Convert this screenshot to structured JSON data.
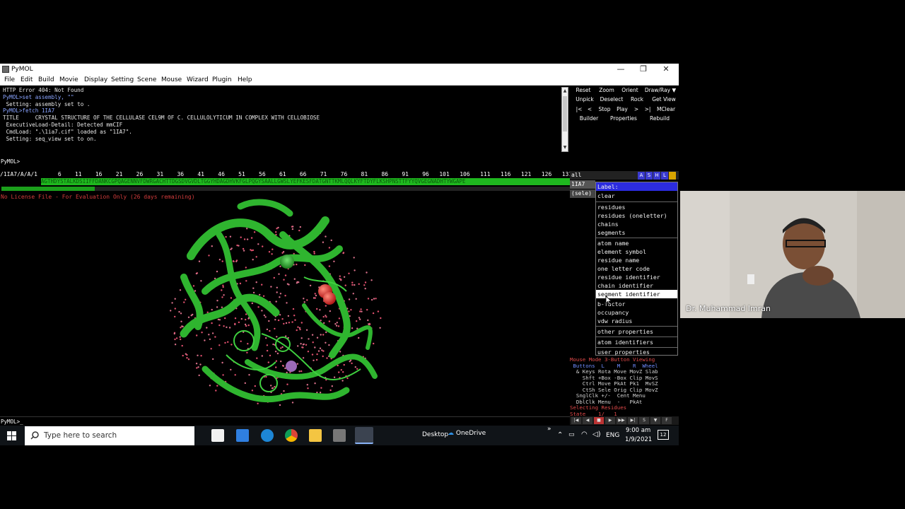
{
  "window": {
    "title": "PyMOL",
    "controls": {
      "minimize": "—",
      "restore": "❐",
      "close": "✕"
    }
  },
  "menu": [
    "File",
    "Edit",
    "Build",
    "Movie",
    "Display",
    "Setting",
    "Scene",
    "Mouse",
    "Wizard",
    "Plugin",
    "Help"
  ],
  "console": {
    "lines": [
      {
        "text": "HTTP Error 404: Not Found",
        "color": "white"
      },
      {
        "text": "PyMOL>set assembly, \"\"",
        "color": "blue"
      },
      {
        "text": " Setting: assembly set to .",
        "color": "white"
      },
      {
        "text": "PyMOL>fetch 1IA7",
        "color": "blue"
      },
      {
        "text": "TITLE     CRYSTAL STRUCTURE OF THE CELLULASE CEL9M OF C. CELLULOLYTICUM IN COMPLEX WITH CELLOBIOSE",
        "color": "white"
      },
      {
        "text": " ExecutiveLoad-Detail: Detected mmCIF",
        "color": "white"
      },
      {
        "text": " CmdLoad: \".\\1ia7.cif\" loaded as \"1IA7\".",
        "color": "white"
      },
      {
        "text": " Setting: seq_view set to on.",
        "color": "white"
      }
    ]
  },
  "controls": {
    "row1": [
      "Reset",
      "Zoom",
      "Orient",
      "Draw/Ray ▼"
    ],
    "row2": [
      "Unpick",
      "Deselect",
      "Rock",
      "Get View"
    ],
    "row3": [
      "|<",
      "<",
      "Stop",
      "Play",
      ">",
      ">|",
      "MClear"
    ],
    "row4": [
      "Builder",
      "Properties",
      "Rebuild"
    ]
  },
  "command_prompt": "PyMOL>",
  "bottom_prompt": "PyMOL>_",
  "sequence": {
    "header": "/1IA7/A/A/1      6    11    16    21    26    31    36    41    46    51    56    61    66    71    76    81    86    91    96   101   106   111   116   121   126   131",
    "residues": "AGTHDYSTALKDSIIFFDANKCGPQAGENNVFDWRGACHTTDGSDVGVDLTGGYHDAGDHVKFGLPQGYSAALLGWSLYEFKESFDATGNTTKMLQQLKYFTDYFLKSHPNSTTFYYQVGEGNADHTYWGAPE"
  },
  "license_notice": "No License File - For Evaluation Only (26 days remaining)",
  "object_panel": {
    "all": "all",
    "obj1": "1IA7",
    "sele": "(sele)",
    "buttons": [
      "A",
      "S",
      "H",
      "L",
      ""
    ]
  },
  "label_menu": {
    "title": "Label:",
    "items": [
      "clear",
      "residues",
      "residues (oneletter)",
      "chains",
      "segments",
      "atom name",
      "element symbol",
      "residue name",
      "one letter code",
      "residue identifier",
      "chain identifier",
      "segment identifier",
      "b-factor",
      "occupancy",
      "vdw radius",
      "other properties",
      "atom identifiers",
      "user properties"
    ],
    "highlighted": "segment identifier"
  },
  "mouse_help": [
    {
      "text": "Mouse Mode 3-Button Viewing",
      "color": "red"
    },
    {
      "text": " Buttons  L    M    R  Wheel",
      "color": "blue"
    },
    {
      "text": "  & Keys Rota Move MovZ Slab",
      "color": "mixed"
    },
    {
      "text": "    Shft +Box -Box Clip MovS",
      "color": "mixed"
    },
    {
      "text": "    Ctrl Move PkAt Pk1  MvSZ",
      "color": "mixed"
    },
    {
      "text": "    CtSh Sele Orig Clip MovZ",
      "color": "mixed"
    },
    {
      "text": "  SnglClk +/-  Cent Menu",
      "color": "mixed"
    },
    {
      "text": "  DblClk Menu  -   PkAt",
      "color": "mixed"
    },
    {
      "text": "Selecting Residues",
      "color": "red"
    },
    {
      "text": "State    1/   1",
      "color": "red"
    }
  ],
  "taskbar": {
    "search_placeholder": "Type here to search",
    "desktop": "Desktop",
    "onedrive": "OneDrive",
    "lang": "ENG",
    "time": "9:00 am",
    "date": "1/9/2021",
    "notifications": "12"
  },
  "webcam": {
    "name": "Dr. Muhammad Imran"
  },
  "colors": {
    "sequence_green": "#1fb81f",
    "ribbon_green": "#2fb52f",
    "menu_bg": "#000000",
    "highlight": "#ffffff"
  }
}
